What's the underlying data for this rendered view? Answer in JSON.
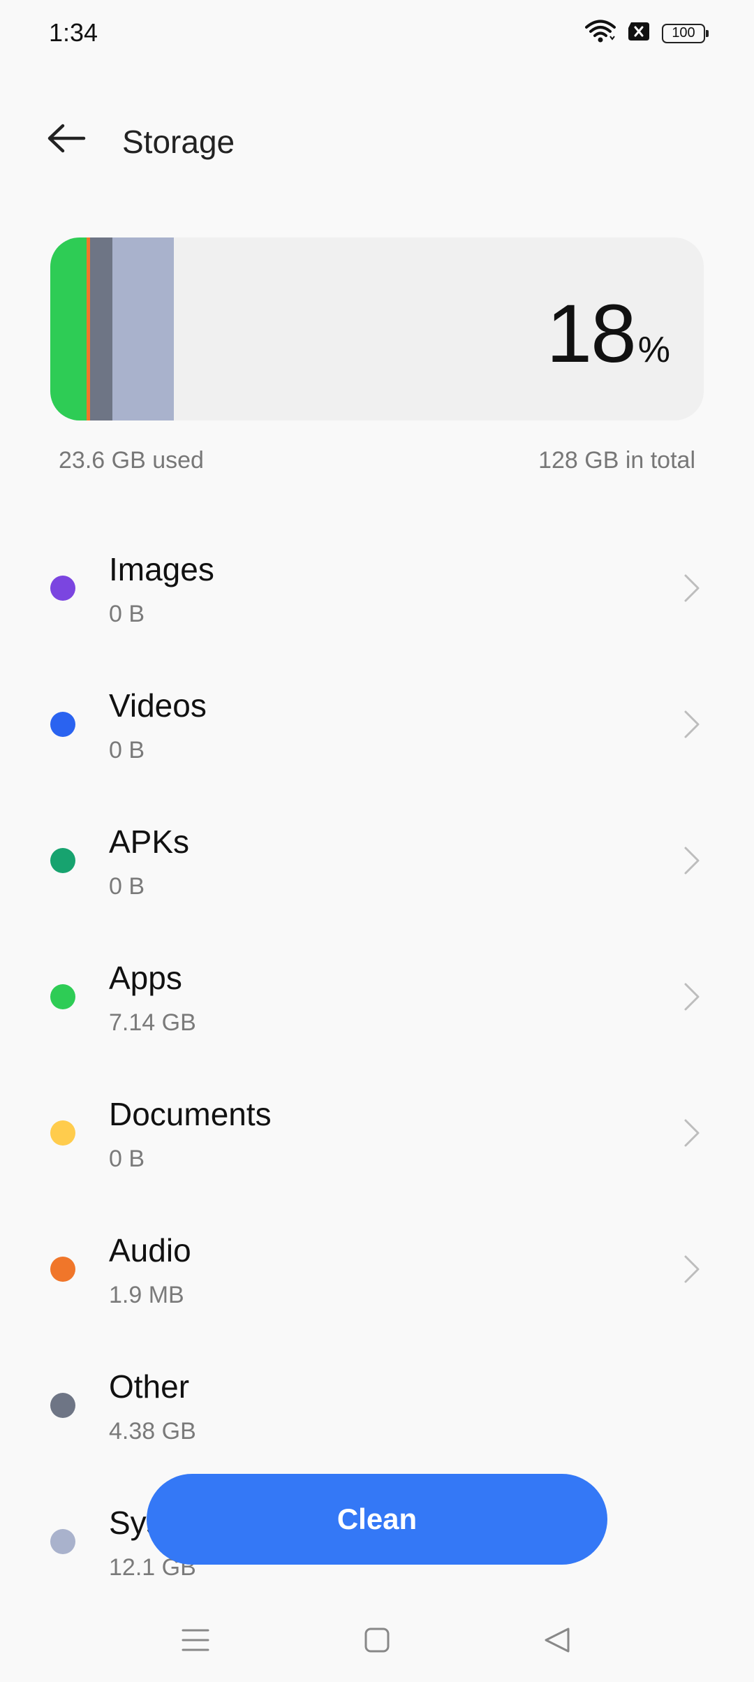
{
  "status_bar": {
    "time": "1:34",
    "battery": "100",
    "icons": [
      "wifi-icon",
      "sim-blocked-icon",
      "battery-icon"
    ]
  },
  "header": {
    "title": "Storage",
    "back_icon": "arrow-left-icon"
  },
  "usage": {
    "percent": "18",
    "percent_sign": "%",
    "used": "23.6 GB used",
    "total": "128 GB in total",
    "bar_fractions": [
      {
        "category": "Apps",
        "fraction": 0.0558,
        "color": "#2ecc55"
      },
      {
        "category": "Audio",
        "fraction": 0.005,
        "color": "#f0762a"
      },
      {
        "category": "Other",
        "fraction": 0.0342,
        "color": "#6e7585"
      },
      {
        "category": "System",
        "fraction": 0.0944,
        "color": "#a9b2cc"
      }
    ]
  },
  "categories": [
    {
      "name": "Images",
      "size": "0 B",
      "color": "#7b45e0",
      "has_chevron": true
    },
    {
      "name": "Videos",
      "size": "0 B",
      "color": "#2a63f0",
      "has_chevron": true
    },
    {
      "name": "APKs",
      "size": "0 B",
      "color": "#17a36f",
      "has_chevron": true
    },
    {
      "name": "Apps",
      "size": "7.14  GB",
      "color": "#2ecc55",
      "has_chevron": true
    },
    {
      "name": "Documents",
      "size": "0 B",
      "color": "#ffcc4d",
      "has_chevron": true
    },
    {
      "name": "Audio",
      "size": "1.9 MB",
      "color": "#f0762a",
      "has_chevron": true
    },
    {
      "name": "Other",
      "size": "4.38 GB",
      "color": "#6e7585",
      "has_chevron": false
    },
    {
      "name": "System",
      "size": "12.1 GB",
      "color": "#a9b2cc",
      "has_chevron": false
    }
  ],
  "actions": {
    "clean_label": "Clean"
  },
  "nav": {
    "items": [
      "menu-icon",
      "home-icon",
      "back-triangle-icon"
    ]
  },
  "colors": {
    "accent": "#3478f6",
    "background": "#f9f9f9",
    "card": "#f0f0f0"
  }
}
